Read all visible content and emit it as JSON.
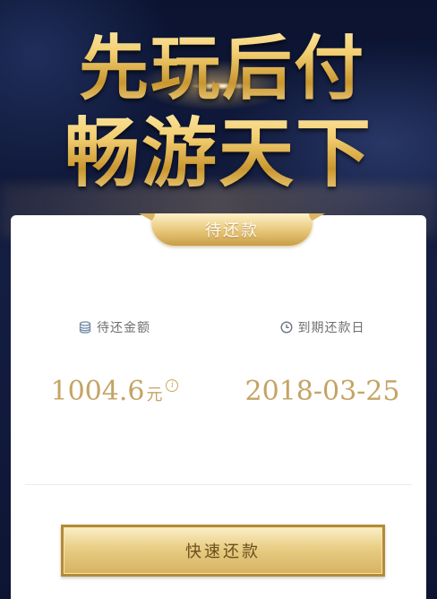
{
  "hero": {
    "line1": "先玩后付",
    "line2": "畅游天下"
  },
  "card": {
    "status_tab": "待还款",
    "amount": {
      "label": "待还金额",
      "icon": "coin-stack-icon",
      "value": "1004.6",
      "unit": "元",
      "info_icon": "info-icon"
    },
    "due_date": {
      "label": "到期还款日",
      "icon": "clock-icon",
      "value": "2018-03-25"
    },
    "pay_button_label": "快速还款"
  },
  "colors": {
    "gold": "#c4a464",
    "navy_background": "#0e1630",
    "label_grey": "#6f6f6f"
  }
}
